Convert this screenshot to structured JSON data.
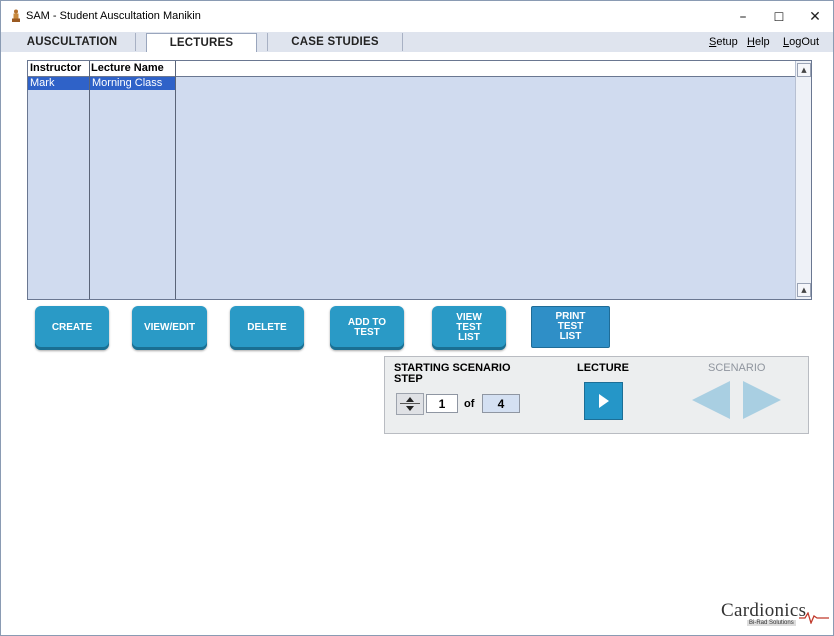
{
  "window": {
    "title": "SAM - Student Auscultation Manikin",
    "minimize": "–",
    "maximize": "☐",
    "close": "✕"
  },
  "tabs": [
    {
      "label": "AUSCULTATION",
      "active": false
    },
    {
      "label": "LECTURES",
      "active": true
    },
    {
      "label": "CASE STUDIES",
      "active": false
    }
  ],
  "menu": {
    "setup_first": "S",
    "setup_rest": "etup",
    "help_first": "H",
    "help_rest": "elp",
    "logout_first": "L",
    "logout_rest": "ogOut"
  },
  "grid": {
    "columns": [
      "Instructor",
      "Lecture  Name"
    ],
    "rows": [
      {
        "instructor": "Mark",
        "lecture_name": "Morning Class",
        "selected": true
      }
    ]
  },
  "actions": {
    "create": "CREATE",
    "view_edit": "VIEW/EDIT",
    "delete": "DELETE",
    "add_to_test_1": "ADD TO",
    "add_to_test_2": "TEST",
    "view_test_list_1": "VIEW",
    "view_test_list_2": "TEST",
    "view_test_list_3": "LIST",
    "print_test_list_1": "PRINT",
    "print_test_list_2": "TEST",
    "print_test_list_3": "LIST"
  },
  "scenario_panel": {
    "starting_label_1": "STARTING SCENARIO",
    "starting_label_2": "STEP",
    "step_current": "1",
    "of_label": "of",
    "step_total": "4",
    "lecture_label": "LECTURE",
    "scenario_label": "SCENARIO"
  },
  "logo": {
    "text": "Cardionics",
    "tagline": "Bi-Rad Solutions"
  },
  "colors": {
    "accent": "#2a9ac6",
    "grid_bg": "#d0dbef",
    "selection": "#2f62c8",
    "tab_bar": "#dfe4ee"
  }
}
